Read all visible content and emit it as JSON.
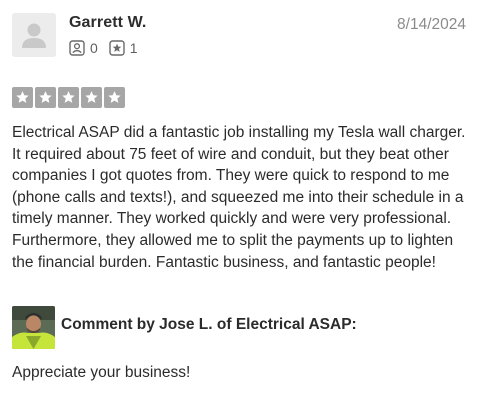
{
  "review": {
    "author": {
      "name": "Garrett W.",
      "avatar_icon": "default-user-avatar-icon",
      "friends_count": "0",
      "friends_icon": "friends-icon",
      "reviews_count": "1",
      "reviews_icon": "review-star-icon"
    },
    "date": "8/14/2024",
    "rating": 5,
    "rating_max": 5,
    "star_color": "#a6a6a6",
    "text": "Electrical ASAP did a fantastic job installing my Tesla wall charger. It required about 75 feet of wire and conduit, but they beat other companies I got quotes from. They were quick to respond to me (phone calls and texts!), and squeezed me into their schedule in a timely manner. They worked quickly and were very professional. Furthermore, they allowed me to split the payments up to lighten the financial burden. Fantastic business, and fantastic people!"
  },
  "response": {
    "heading": "Comment by Jose L. of Electrical ASAP:",
    "text": "Appreciate your business!",
    "avatar_icon": "business-owner-photo"
  }
}
